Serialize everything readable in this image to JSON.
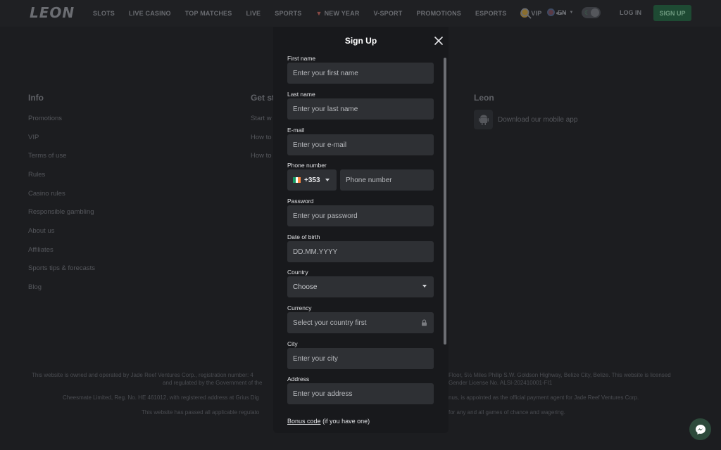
{
  "header": {
    "logo": "LEON",
    "nav": [
      {
        "label": "SLOTS"
      },
      {
        "label": "LIVE CASINO"
      },
      {
        "label": "TOP MATCHES"
      },
      {
        "label": "LIVE"
      },
      {
        "label": "SPORTS"
      },
      {
        "label": "NEW YEAR"
      },
      {
        "label": "V-SPORT"
      },
      {
        "label": "PROMOTIONS"
      },
      {
        "label": "ESPORTS"
      },
      {
        "label": "VIP"
      }
    ],
    "more": "•••",
    "language": "EN",
    "login": "LOG IN",
    "signup": "SIGN UP"
  },
  "footer": {
    "info_title": "Info",
    "info_links": [
      "Promotions",
      "VIP",
      "Terms of use",
      "Rules",
      "Casino rules",
      "Responsible gambling",
      "About us",
      "Affiliates",
      "Sports tips & forecasts",
      "Blog"
    ],
    "get_started_title": "Get st",
    "get_started_links": [
      "Start w",
      "How to",
      "How to"
    ],
    "leon_title": "Leon",
    "app_link": "Download our mobile app",
    "legal": [
      "This website is owned and operated by Jade Reef Ventures Corp., registration number: 4",
      "Floor, 5½ Miles Philip S.W. Goldson Highway, Belize City, Belize. This website is licensed",
      "and regulated by the Government of the",
      "Gender License No. ALSI-202410001-FI1",
      "Cheesmate Limited, Reg. No. HE 461012, with registered address at Grius Dig",
      "nus, is appointed as the official payment agent for Jade Reef Ventures Corp.",
      "This website has passed all applicable regulato",
      "for any and all games of chance and wagering."
    ]
  },
  "modal": {
    "title": "Sign Up",
    "fields": {
      "first_name": {
        "label": "First name",
        "placeholder": "Enter your first name"
      },
      "last_name": {
        "label": "Last name",
        "placeholder": "Enter your last name"
      },
      "email": {
        "label": "E-mail",
        "placeholder": "Enter your e-mail"
      },
      "phone": {
        "label": "Phone number",
        "code": "+353",
        "placeholder": "Phone number"
      },
      "password": {
        "label": "Password",
        "placeholder": "Enter your password"
      },
      "dob": {
        "label": "Date of birth",
        "placeholder": "DD.MM.YYYY"
      },
      "country": {
        "label": "Country",
        "value": "Choose"
      },
      "currency": {
        "label": "Currency",
        "value": "Select your country first"
      },
      "city": {
        "label": "City",
        "placeholder": "Enter your city"
      },
      "address": {
        "label": "Address",
        "placeholder": "Enter your address"
      }
    },
    "bonus_link": "Bonus code",
    "bonus_note": "(if you have one)"
  },
  "icons": {
    "close": "close-icon",
    "search": "search-icon",
    "lock": "lock-icon",
    "chat": "messenger-icon",
    "android": "android-icon"
  }
}
